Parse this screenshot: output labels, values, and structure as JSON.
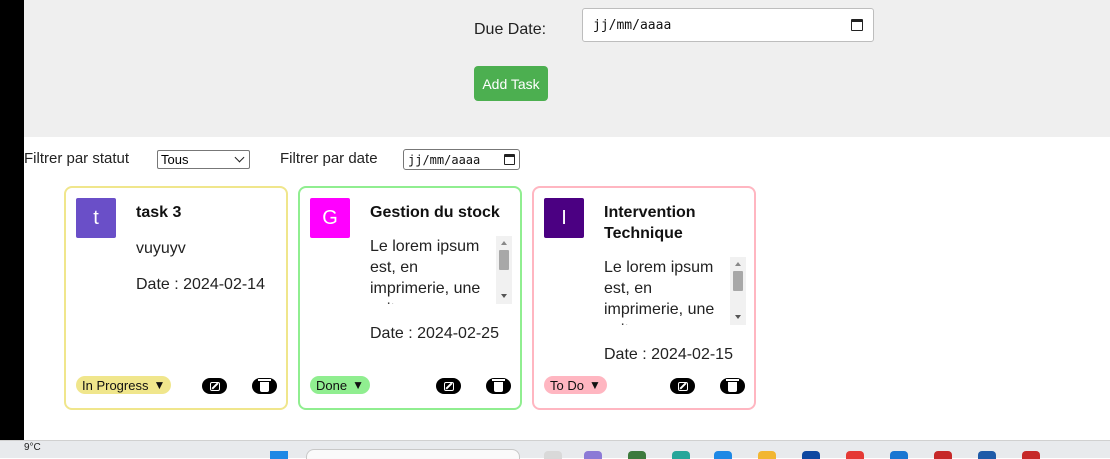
{
  "form": {
    "due_date_label": "Due Date:",
    "due_date_placeholder": "jj/mm/aaaa",
    "add_button_label": "Add Task"
  },
  "filters": {
    "status_label": "Filtrer par statut",
    "status_selected": "Tous",
    "date_label": "Filtrer par date",
    "date_placeholder": "jj/mm/aaaa"
  },
  "cards": [
    {
      "initial": "t",
      "avatar_color": "#6a4fc8",
      "border_color": "#f0e68c",
      "title": "task 3",
      "description": "vuyuyv",
      "date": "Date : 2024-02-14",
      "status": "In Progress",
      "status_color": "#f0e68c"
    },
    {
      "initial": "G",
      "avatar_color": "#ff00ff",
      "border_color": "#90ee90",
      "title": "Gestion du stock",
      "description": "Le lorem ipsum est, en imprimerie, une suite",
      "date": "Date : 2024-02-25",
      "status": "Done",
      "status_color": "#90ee90"
    },
    {
      "initial": "I",
      "avatar_color": "#4b0082",
      "border_color": "#ffb6c1",
      "title": "Intervention Technique",
      "description": "Le lorem ipsum est, en imprimerie, une suite",
      "date": "Date : 2024-02-15",
      "status": "To Do",
      "status_color": "#ffb6c1"
    }
  ],
  "taskbar": {
    "temperature": "9°C"
  }
}
